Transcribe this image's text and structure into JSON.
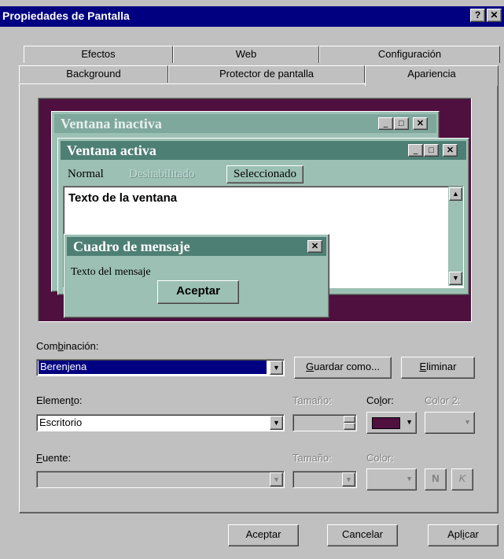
{
  "window": {
    "title": "Propiedades de Pantalla",
    "help_glyph": "?",
    "close_glyph": "✕"
  },
  "tabs": {
    "row1": [
      "Efectos",
      "Web",
      "Configuración"
    ],
    "row2": [
      "Background",
      "Protector de pantalla",
      "Apariencia"
    ],
    "active": "Apariencia"
  },
  "preview": {
    "inactive_title": "Ventana inactiva",
    "active_title": "Ventana activa",
    "menu": [
      "Normal",
      "Deshabilitado",
      "Seleccionado"
    ],
    "window_text": "Texto de la ventana",
    "msgbox_title": "Cuadro de mensaje",
    "msgbox_text": "Texto del mensaje",
    "msgbox_button": "Aceptar",
    "colors": {
      "desktop": "#4f0f3f",
      "window_frame": "#9cc0b4",
      "title_active": "#4e7f74",
      "title_inactive": "#7fa89d"
    }
  },
  "scheme": {
    "label_pre": "Com",
    "label_ul": "b",
    "label_post": "inación:",
    "value": "Berenjena",
    "save_pre": "",
    "save_ul": "G",
    "save_post": "uardar como...",
    "delete_pre": "",
    "delete_ul": "E",
    "delete_post": "liminar"
  },
  "item": {
    "label_pre": "Elemen",
    "label_ul": "t",
    "label_post": "o:",
    "value": "Escritorio",
    "size_label": "Tamaño:",
    "color_label_pre": "Co",
    "color_label_ul": "l",
    "color_label_post": "or:",
    "color2_label": "Color 2:",
    "color_value": "#4f0f3f"
  },
  "font": {
    "label_pre": "",
    "label_ul": "F",
    "label_post": "uente:",
    "size_label": "Tamaño:",
    "color_label": "Color:",
    "bold": "N",
    "italic": "K"
  },
  "buttons": {
    "ok": "Aceptar",
    "cancel": "Cancelar",
    "apply_pre": "Apl",
    "apply_ul": "i",
    "apply_post": "car"
  }
}
